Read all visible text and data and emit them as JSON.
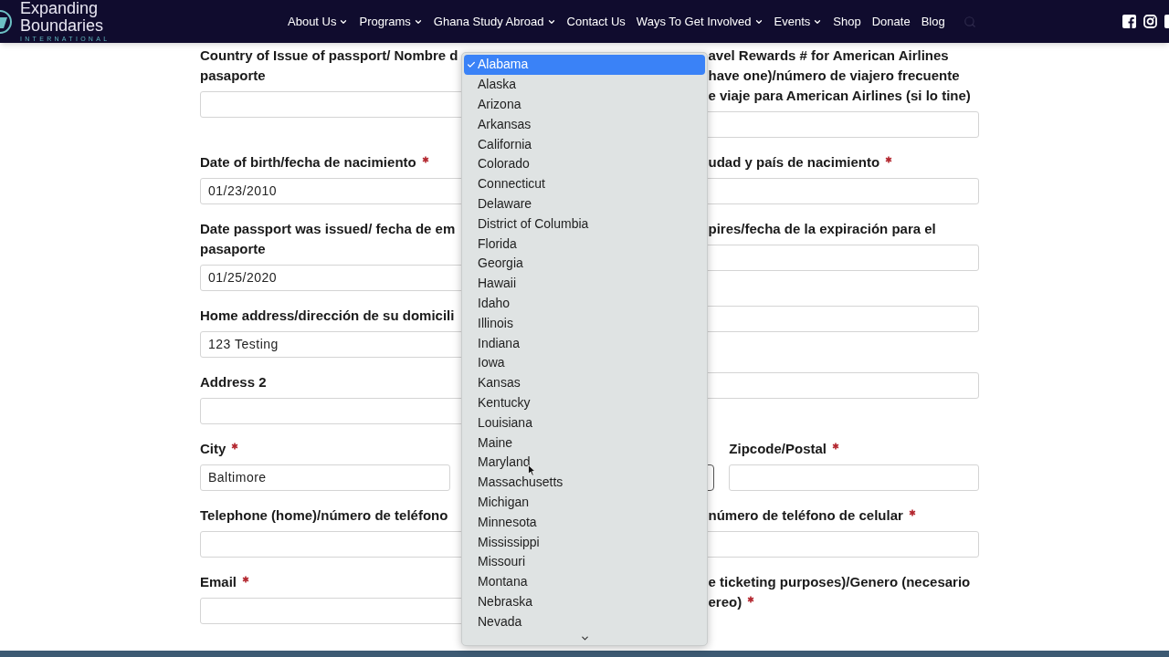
{
  "header": {
    "logo": {
      "line1": "Expanding",
      "line2": "Boundaries",
      "tagline": "INTERNATIONAL"
    },
    "nav": [
      {
        "label": "About Us",
        "has_menu": true
      },
      {
        "label": "Programs",
        "has_menu": true
      },
      {
        "label": "Ghana Study Abroad",
        "has_menu": true
      },
      {
        "label": "Contact Us",
        "has_menu": false
      },
      {
        "label": "Ways To Get Involved",
        "has_menu": true
      },
      {
        "label": "Events",
        "has_menu": true
      },
      {
        "label": "Shop",
        "has_menu": false
      },
      {
        "label": "Donate",
        "has_menu": false
      },
      {
        "label": "Blog",
        "has_menu": false
      }
    ]
  },
  "form": {
    "rows": [
      {
        "kind": "pair",
        "left": {
          "label_lines": [
            "Country of Issue of passport/ Nombre d",
            "pasaporte"
          ]
        },
        "right": {
          "label_lines": [
            "avel Rewards # for American Airlines",
            "have one)/número de viajero frecuente",
            "e viaje para American Airlines (si lo tine)"
          ]
        }
      },
      {
        "kind": "pair",
        "left": {
          "label_lines": [
            "Date of birth/fecha de nacimiento"
          ],
          "required": true,
          "value": "01/23/2010"
        },
        "right": {
          "label_lines": [
            "udad y país de nacimiento"
          ],
          "required": true
        }
      },
      {
        "kind": "pair",
        "left": {
          "label_lines": [
            "Date passport was issued/ fecha de em",
            "pasaporte"
          ],
          "value": "01/25/2020"
        },
        "right": {
          "label_lines": [
            "pires/fecha de la expiración para el"
          ]
        }
      },
      {
        "kind": "pair",
        "left": {
          "label_lines": [
            "Home address/dirección de su domicili"
          ],
          "value": "123 Testing"
        },
        "right": {}
      },
      {
        "kind": "pair",
        "left": {
          "label_lines": [
            "Address 2"
          ]
        },
        "right": {}
      },
      {
        "kind": "triple",
        "columns": [
          {
            "kind": "text",
            "label_lines": [
              "City"
            ],
            "required": true,
            "value": "Baltimore"
          },
          {
            "kind": "select"
          },
          {
            "kind": "text",
            "label_lines": [
              "Zipcode/Postal"
            ],
            "required": true
          }
        ]
      },
      {
        "kind": "pair",
        "left": {
          "label_lines": [
            "Telephone (home)/número de teléfono"
          ]
        },
        "right": {
          "label_lines": [
            "número de teléfono de celular"
          ],
          "required": true
        }
      },
      {
        "kind": "pair",
        "left": {
          "label_lines": [
            "Email"
          ],
          "required": true
        },
        "right": {
          "label_lines": [
            "e ticketing purposes)/Genero (necesario",
            "ereo)"
          ],
          "required": true,
          "no_field": true
        }
      }
    ]
  },
  "dropdown": {
    "options": [
      {
        "label": "Alabama",
        "selected": true
      },
      {
        "label": "Alaska",
        "selected": false
      },
      {
        "label": "Arizona",
        "selected": false
      },
      {
        "label": "Arkansas",
        "selected": false
      },
      {
        "label": "California",
        "selected": false
      },
      {
        "label": "Colorado",
        "selected": false
      },
      {
        "label": "Connecticut",
        "selected": false
      },
      {
        "label": "Delaware",
        "selected": false
      },
      {
        "label": "District of Columbia",
        "selected": false
      },
      {
        "label": "Florida",
        "selected": false
      },
      {
        "label": "Georgia",
        "selected": false
      },
      {
        "label": "Hawaii",
        "selected": false
      },
      {
        "label": "Idaho",
        "selected": false
      },
      {
        "label": "Illinois",
        "selected": false
      },
      {
        "label": "Indiana",
        "selected": false
      },
      {
        "label": "Iowa",
        "selected": false
      },
      {
        "label": "Kansas",
        "selected": false
      },
      {
        "label": "Kentucky",
        "selected": false
      },
      {
        "label": "Louisiana",
        "selected": false
      },
      {
        "label": "Maine",
        "selected": false
      },
      {
        "label": "Maryland",
        "selected": false
      },
      {
        "label": "Massachusetts",
        "selected": false
      },
      {
        "label": "Michigan",
        "selected": false
      },
      {
        "label": "Minnesota",
        "selected": false
      },
      {
        "label": "Mississippi",
        "selected": false
      },
      {
        "label": "Missouri",
        "selected": false
      },
      {
        "label": "Montana",
        "selected": false
      },
      {
        "label": "Nebraska",
        "selected": false
      },
      {
        "label": "Nevada",
        "selected": false
      }
    ]
  }
}
